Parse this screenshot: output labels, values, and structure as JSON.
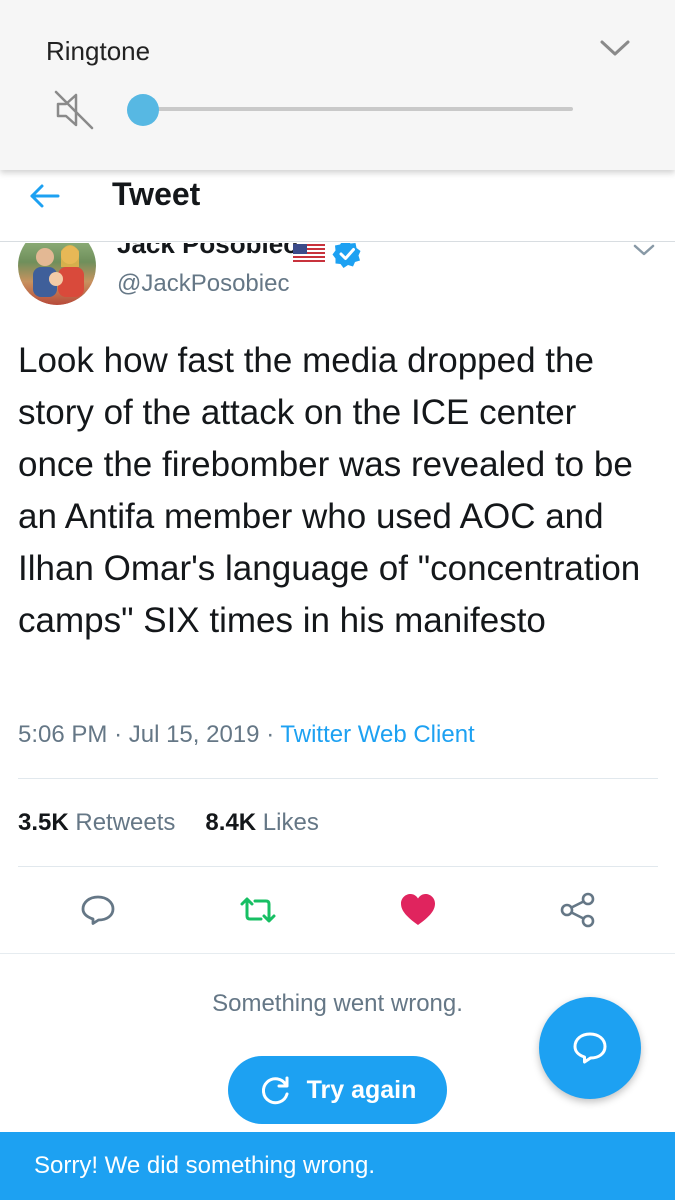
{
  "ringtone": {
    "title": "Ringtone",
    "volume_level": 0.0,
    "icons": {
      "mute": "speaker-muted-icon",
      "collapse": "chevron-down-icon"
    }
  },
  "header": {
    "title": "Tweet",
    "back_icon": "arrow-left-icon"
  },
  "tweet": {
    "author_name": "Jack Posobiec",
    "author_handle": "@JackPosobiec",
    "text": "Look how fast the media dropped the story of the attack on the ICE center once the firebomber was revealed to be an Antifa member who used AOC and Ilhan Omar's language of \"concentration camps\" SIX times in his manifesto",
    "time": "5:06 PM",
    "date": "Jul 15, 2019",
    "separator": "·",
    "client": "Twitter Web Client",
    "retweets_count": "3.5K",
    "retweets_label": "Retweets",
    "likes_count": "8.4K",
    "likes_label": "Likes",
    "liked": true
  },
  "error": {
    "message": "Something went wrong.",
    "retry_label": "Try again"
  },
  "snackbar": {
    "message": "Sorry! We did something wrong."
  },
  "colors": {
    "accent": "#1da1f2",
    "retweet": "#17bf63",
    "like": "#e0245e",
    "slider": "#57b8e3",
    "muted_text": "#657786"
  }
}
